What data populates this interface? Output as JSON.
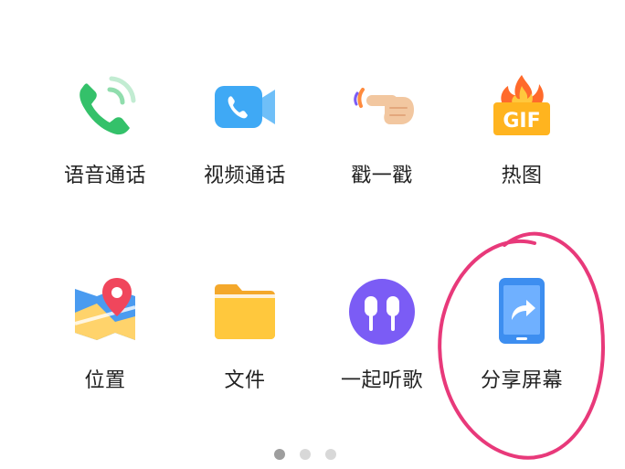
{
  "apps": [
    {
      "label": "语音通话",
      "icon": "voice-call-icon"
    },
    {
      "label": "视频通话",
      "icon": "video-call-icon"
    },
    {
      "label": "戳一戳",
      "icon": "poke-icon"
    },
    {
      "label": "热图",
      "icon": "hot-gif-icon"
    },
    {
      "label": "位置",
      "icon": "location-icon"
    },
    {
      "label": "文件",
      "icon": "folder-icon"
    },
    {
      "label": "一起听歌",
      "icon": "listen-together-icon"
    },
    {
      "label": "分享屏幕",
      "icon": "share-screen-icon"
    }
  ],
  "gif_badge": "GIF",
  "pagination": {
    "pages": 3,
    "current": 1
  },
  "colors": {
    "voice_green": "#34C16A",
    "video_blue": "#3FA9F5",
    "folder_yellow": "#FFC83D",
    "music_purple": "#7B5CF5",
    "share_blue": "#3D8EF0",
    "annotation_pink": "#E8397A"
  }
}
